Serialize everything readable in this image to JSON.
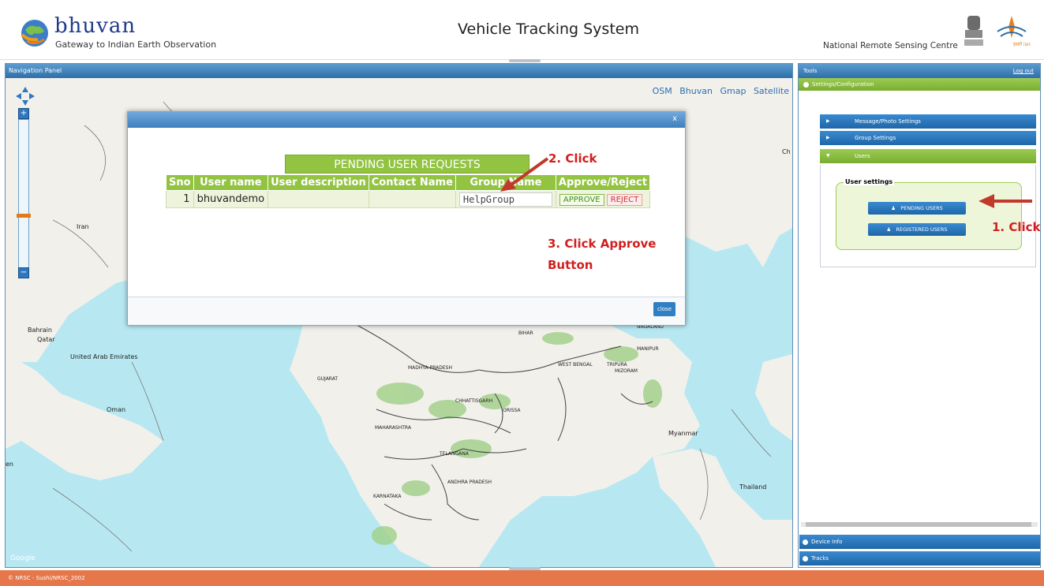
{
  "header": {
    "brand": "bhuvan",
    "tagline": "Gateway to Indian Earth Observation",
    "title": "Vehicle Tracking System",
    "org": "National Remote Sensing Centre"
  },
  "nav_panel": {
    "title": "Navigation Panel",
    "basemaps": [
      "OSM",
      "Bhuvan",
      "Gmap",
      "Satellite"
    ],
    "labels": {
      "iran": "Iran",
      "bahrain": "Bahrain",
      "qatar": "Qatar",
      "uae": "United Arab Emirates",
      "oman": "Oman",
      "myanmar": "Myanmar",
      "thailand": "Thailand",
      "gujarat": "GUJARAT",
      "mp": "MADHYA PRADESH",
      "maharashtra": "MAHARASHTRA",
      "telangana": "TELANGANA",
      "ap": "ANDHRA PRADESH",
      "karnataka": "KARNATAKA",
      "chhattisgarh": "CHHATTISGARH",
      "orissa": "ORISSA",
      "wb": "WEST BENGAL",
      "bihar": "BIHAR",
      "tripura": "TRIPURA",
      "mizoram": "MIZORAM",
      "manipur": "MANIPUR",
      "nagaland": "NAGALAND",
      "ch": "Ch",
      "en": "en",
      "google": "Google"
    }
  },
  "modal": {
    "close_x": "x",
    "heading": "PENDING USER REQUESTS",
    "columns": [
      "Sno",
      "User name",
      "User description",
      "Contact Name",
      "Group Name",
      "Approve/Reject"
    ],
    "row": {
      "sno": "1",
      "username": "bhuvandemo",
      "description": "",
      "contact": "",
      "group": "HelpGroup",
      "approve": "APPROVE",
      "reject": "REJECT"
    },
    "close_label": "close"
  },
  "annotations": {
    "step1": "1. Click",
    "step2": "2. Click",
    "step3_line1": "3. Click Approve",
    "step3_line2": "Button"
  },
  "tools": {
    "title": "Tools",
    "logout": "Log out",
    "settings": "Settings/Configuration",
    "message_photo": "Message/Photo Settings",
    "group_settings": "Group Settings",
    "users": "Users",
    "user_settings": "User settings",
    "pending_users": "PENDING USERS",
    "registered_users": "REGISTERED USERS",
    "device_info": "Device Info",
    "tracks": "Tracks"
  },
  "footer": {
    "text": "© NRSC - Sushi/NRSC_2002"
  },
  "colors": {
    "accent_blue": "#2e6fa8",
    "accent_green": "#92c441",
    "footer": "#e5774a",
    "annotation": "#d11f1f",
    "sea": "#b7e8f2"
  }
}
